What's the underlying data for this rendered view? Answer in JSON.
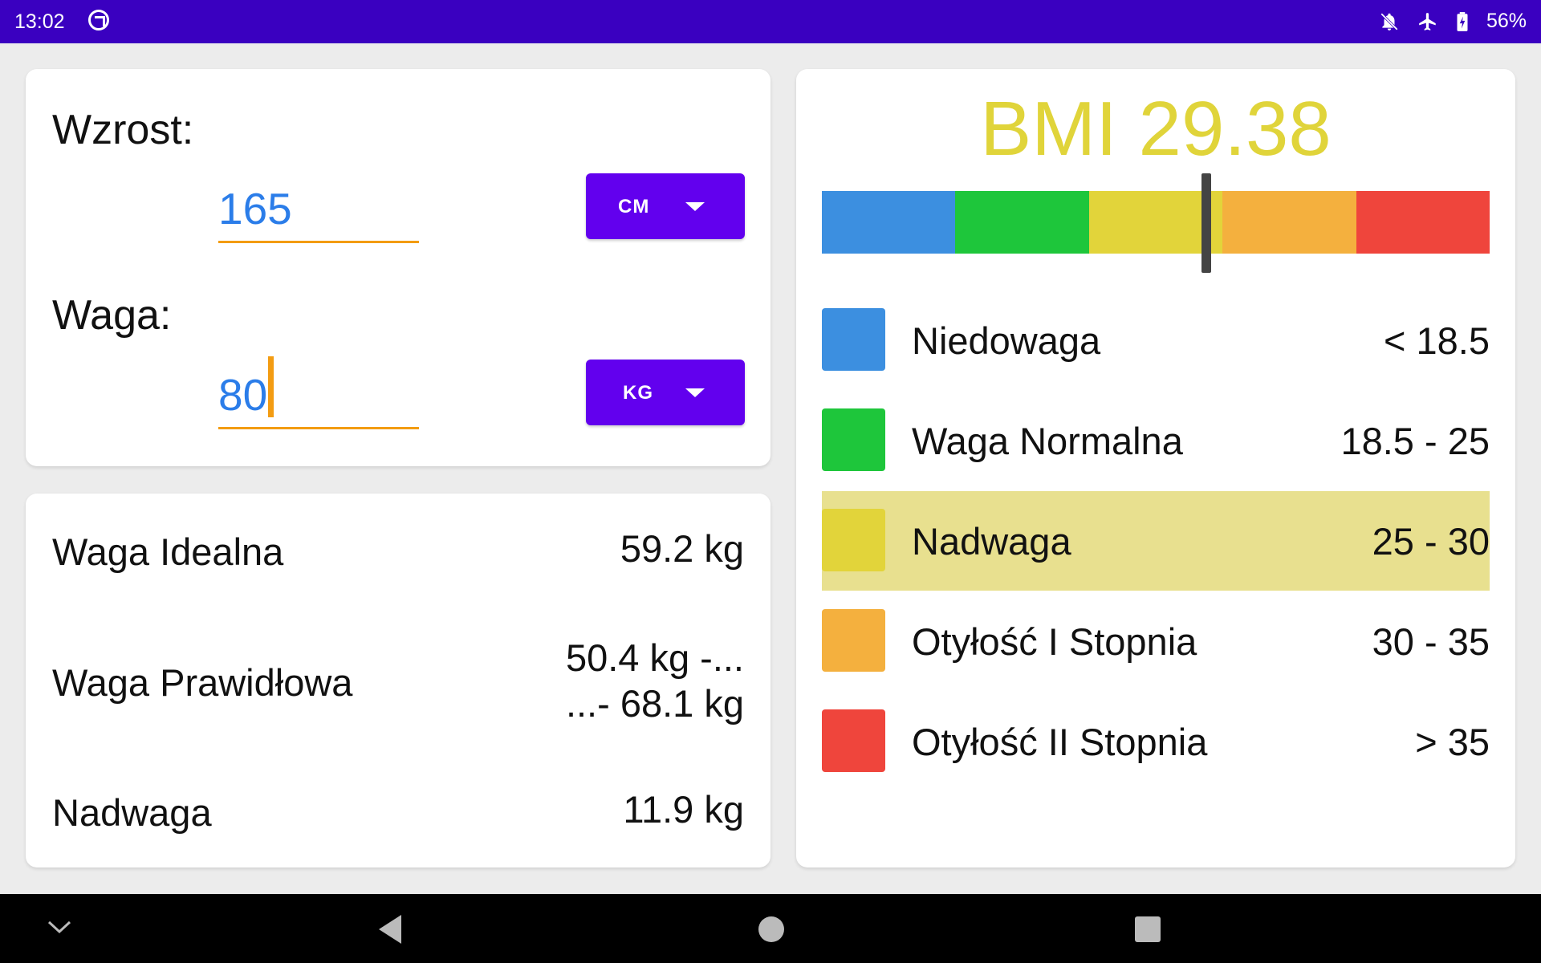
{
  "status_bar": {
    "time": "13:02",
    "battery": "56%",
    "icons": [
      "sync-ring-icon",
      "notifications-off-icon",
      "airplane-mode-icon",
      "battery-charging-icon"
    ]
  },
  "input": {
    "height_label": "Wzrost:",
    "height_value": "165",
    "height_unit": "CM",
    "weight_label": "Waga:",
    "weight_value": "80",
    "weight_unit": "KG"
  },
  "results": {
    "ideal_label": "Waga Idealna",
    "ideal_value": "59.2 kg",
    "normal_label": "Waga Prawidłowa",
    "normal_value_line1": "50.4 kg -...",
    "normal_value_line2": "...- 68.1 kg",
    "overweight_label": "Nadwaga",
    "overweight_value": "11.9 kg"
  },
  "bmi": {
    "title": "BMI 29.38",
    "value": 29.38,
    "categories": [
      {
        "name": "Niedowaga",
        "range": "< 18.5",
        "color": "#3c8fe0"
      },
      {
        "name": "Waga Normalna",
        "range": "18.5 - 25",
        "color": "#1ec63b"
      },
      {
        "name": "Nadwaga",
        "range": "25 - 30",
        "color": "#e2d43a",
        "highlighted": true
      },
      {
        "name": "Otyłość I Stopnia",
        "range": "30 - 35",
        "color": "#f4b03e"
      },
      {
        "name": "Otyłość II Stopnia",
        "range": "> 35",
        "color": "#ef453c"
      }
    ]
  },
  "colors": {
    "status_bar": "#3a00c0",
    "accent_button": "#6200ee",
    "input_text": "#2b7de9",
    "underline": "#f39c12",
    "bmi_title": "#e0d43a",
    "highlight_row": "#e8e08f"
  },
  "navbar": {
    "icons": [
      "collapse-chevron-icon",
      "back-icon",
      "home-icon",
      "recents-icon"
    ]
  }
}
